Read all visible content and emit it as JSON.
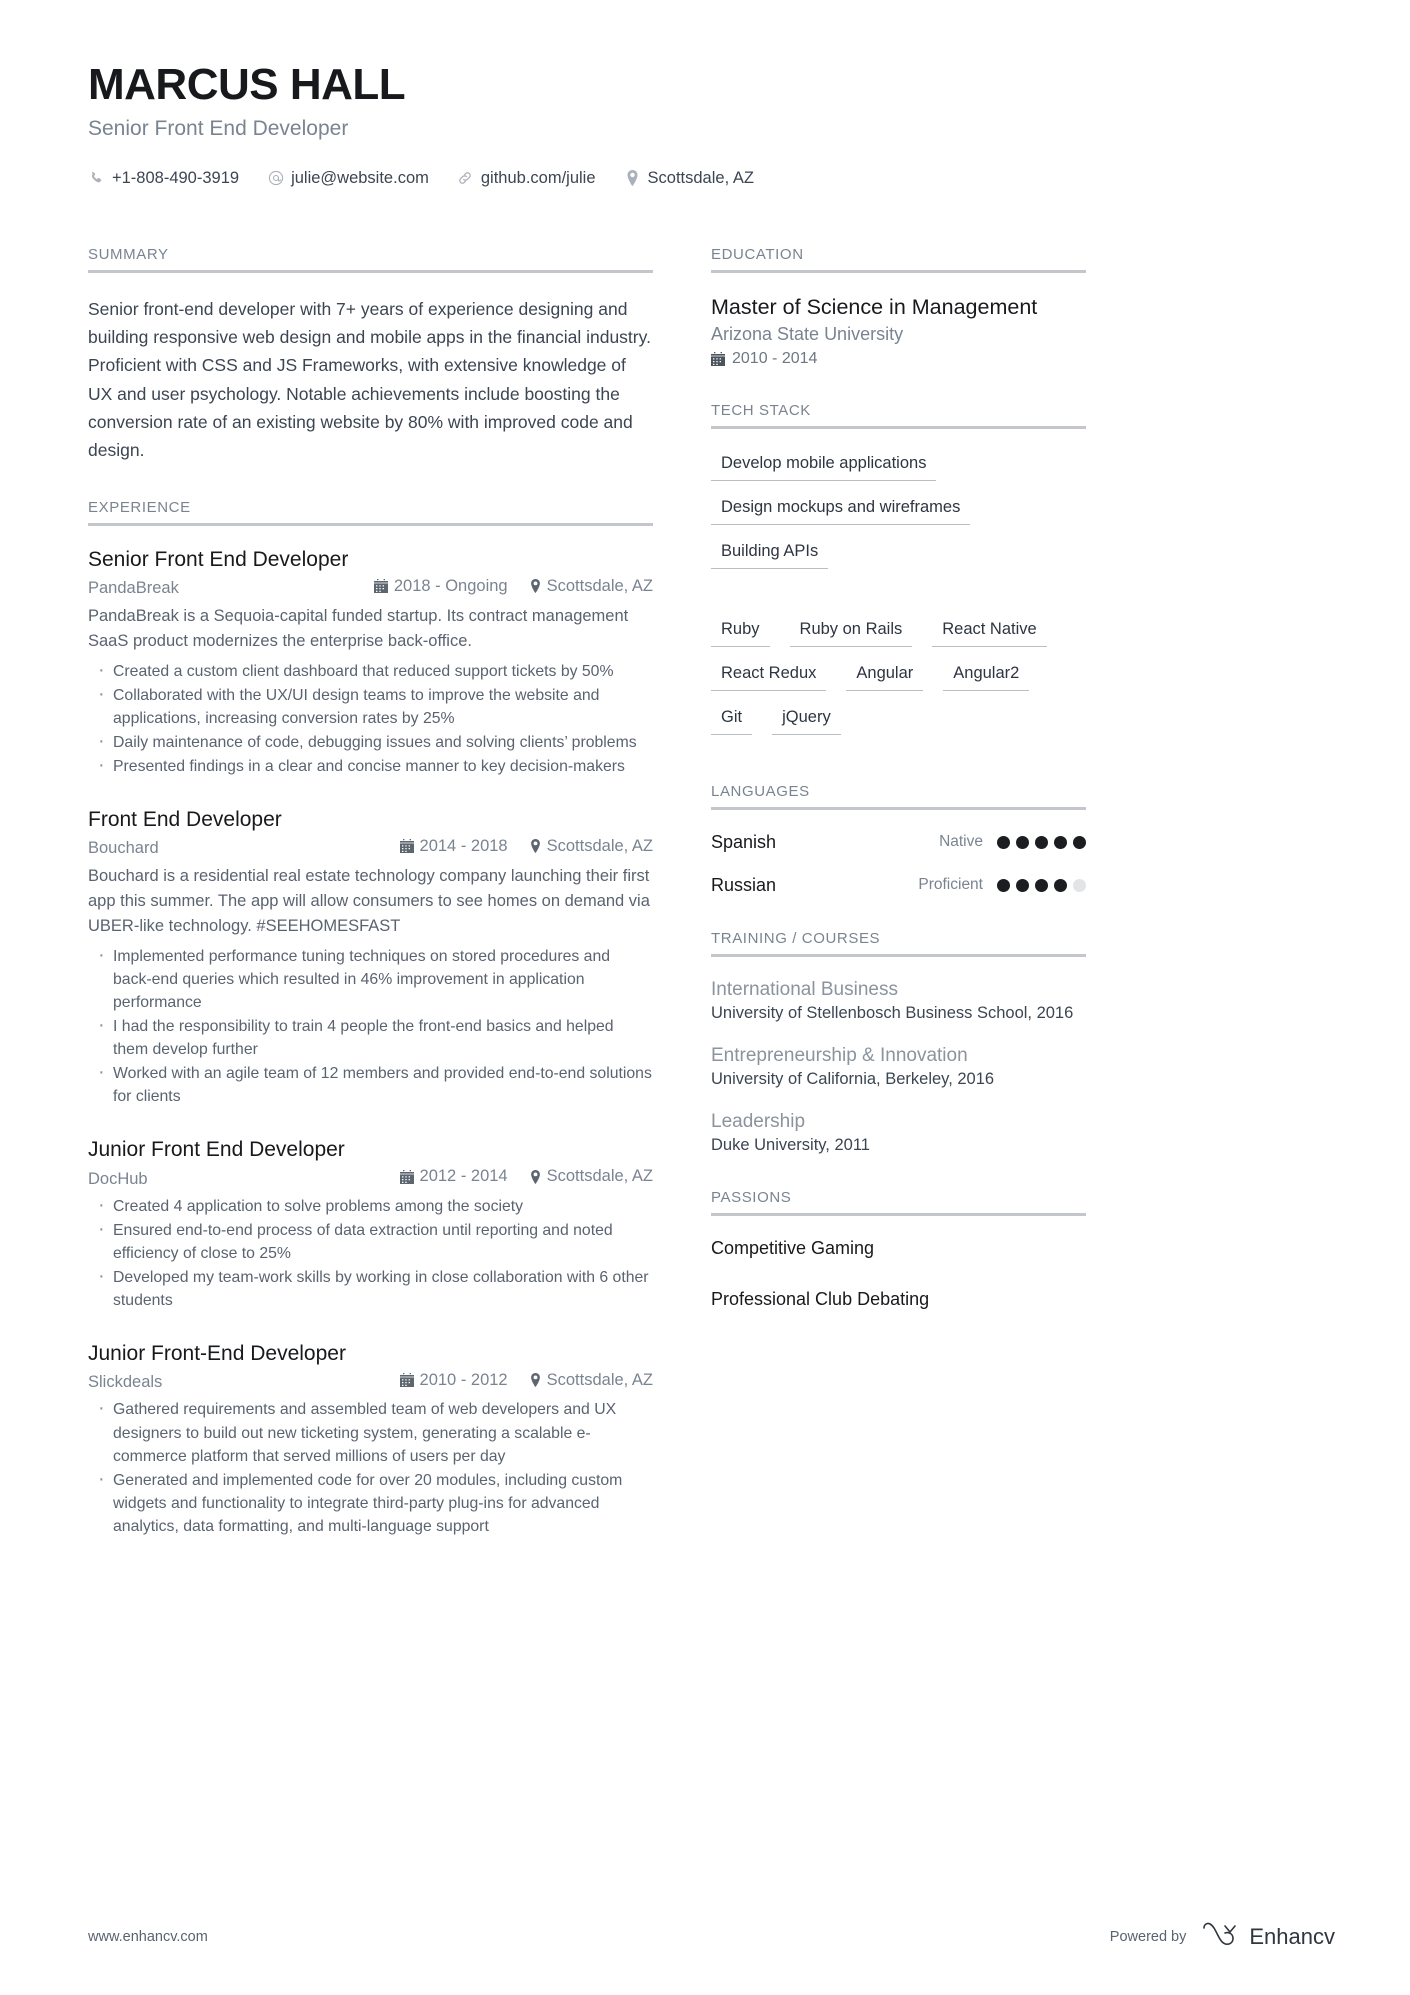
{
  "header": {
    "name": "MARCUS HALL",
    "role": "Senior Front End Developer",
    "contacts": [
      {
        "icon": "phone-icon",
        "value": "+1-808-490-3919"
      },
      {
        "icon": "email-icon",
        "value": "julie@website.com"
      },
      {
        "icon": "link-icon",
        "value": "github.com/julie"
      },
      {
        "icon": "location-pin-icon",
        "value": "Scottsdale, AZ"
      }
    ]
  },
  "summary": {
    "title": "SUMMARY",
    "text": "Senior front-end developer with 7+ years of experience designing and building responsive web design and mobile apps in the financial industry. Proficient with CSS and JS Frameworks, with extensive knowledge of UX and user psychology. Notable achievements include boosting the conversion rate of an existing website by 80% with improved code and design."
  },
  "experience": {
    "title": "EXPERIENCE",
    "jobs": [
      {
        "title": "Senior Front End Developer",
        "company": "PandaBreak",
        "date": "2018 - Ongoing",
        "location": "Scottsdale, AZ",
        "description": "PandaBreak is a Sequoia-capital funded startup. Its contract management SaaS product modernizes the enterprise back-office.",
        "bullets": [
          "Created a custom client dashboard that reduced support tickets by 50%",
          "Collaborated with the UX/UI design teams to improve the website and applications, increasing conversion rates by 25%",
          "Daily maintenance of code, debugging issues and solving clients’ problems",
          "Presented findings in a clear and concise manner to key decision-makers"
        ]
      },
      {
        "title": "Front End Developer",
        "company": "Bouchard",
        "date": "2014 - 2018",
        "location": "Scottsdale, AZ",
        "description": "Bouchard is a residential real estate technology company launching their first app this summer. The app will allow consumers to see homes on demand via UBER-like technology. #SEEHOMESFAST",
        "bullets": [
          "Implemented performance tuning techniques on stored procedures and back-end queries which resulted in 46% improvement in application performance",
          "I had the responsibility to train 4 people the front-end basics and helped them develop further",
          "Worked with an agile team of 12 members and provided end-to-end solutions for clients"
        ]
      },
      {
        "title": "Junior Front End Developer",
        "company": "DocHub",
        "date": "2012 - 2014",
        "location": "Scottsdale, AZ",
        "description": "",
        "bullets": [
          "Created 4 application to solve problems among the society",
          "Ensured end-to-end process of data extraction until reporting and noted efficiency of close to 25%",
          "Developed my team-work skills by working in close collaboration with 6 other students"
        ]
      },
      {
        "title": "Junior Front-End Developer",
        "company": "Slickdeals",
        "date": "2010 - 2012",
        "location": "Scottsdale, AZ",
        "description": "",
        "bullets": [
          "Gathered requirements and assembled team of web developers and UX designers to build out new ticketing system, generating a scalable e-commerce platform that served millions of users per day",
          "Generated and implemented code for over 20 modules, including custom widgets and functionality to integrate third-party plug-ins for advanced analytics, data formatting, and multi-language support"
        ]
      }
    ]
  },
  "education": {
    "title": "EDUCATION",
    "degree": "Master of Science in Management",
    "school": "Arizona State University",
    "date": "2010 - 2014"
  },
  "tech_stack": {
    "title": "TECH STACK",
    "primary": [
      "Develop mobile applications",
      "Design mockups and wireframes",
      "Building APIs"
    ],
    "skills": [
      "Ruby",
      "Ruby on Rails",
      "React Native",
      "React Redux",
      "Angular",
      "Angular2",
      "Git",
      "jQuery"
    ]
  },
  "languages": {
    "title": "LANGUAGES",
    "items": [
      {
        "name": "Spanish",
        "level": "Native",
        "rating": 5,
        "max": 5
      },
      {
        "name": "Russian",
        "level": "Proficient",
        "rating": 4,
        "max": 5
      }
    ]
  },
  "training": {
    "title": "TRAINING / COURSES",
    "items": [
      {
        "name": "International Business",
        "detail": "University of Stellenbosch Business School, 2016"
      },
      {
        "name": "Entrepreneurship & Innovation",
        "detail": "University of California, Berkeley, 2016"
      },
      {
        "name": "Leadership",
        "detail": "Duke University, 2011"
      }
    ]
  },
  "passions": {
    "title": "PASSIONS",
    "items": [
      "Competitive Gaming",
      "Professional Club Debating"
    ]
  },
  "footer": {
    "website": "www.enhancv.com",
    "powered_by": "Powered by",
    "brand": "Enhancv"
  }
}
